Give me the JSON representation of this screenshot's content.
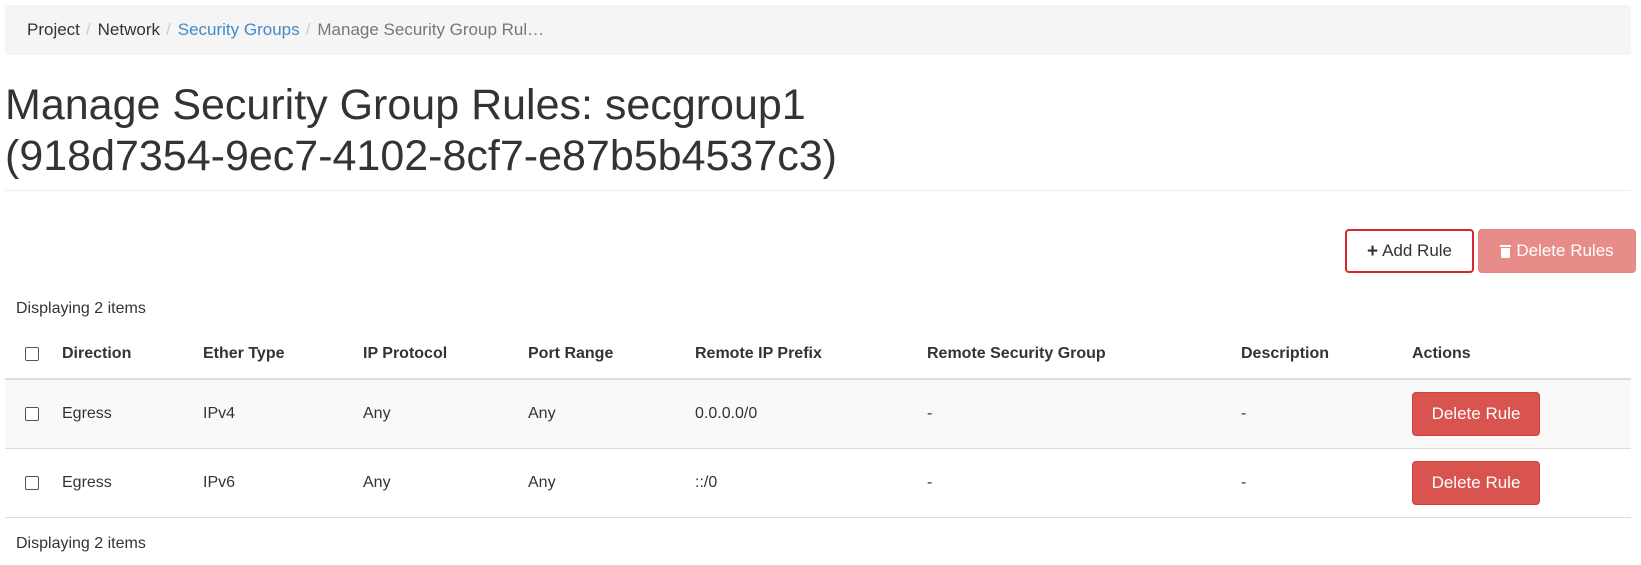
{
  "breadcrumb": {
    "items": [
      "Project",
      "Network",
      "Security Groups",
      "Manage Security Group Rul…"
    ],
    "separator": "/"
  },
  "page": {
    "title_line1": "Manage Security Group Rules: secgroup1",
    "title_line2": "(918d7354-9ec7-4102-8cf7-e87b5b4537c3)"
  },
  "actions": {
    "add_rule_label": "Add Rule",
    "add_rule_icon": "plus-icon",
    "delete_rules_label": "Delete Rules",
    "delete_rules_icon": "trash-icon"
  },
  "table": {
    "count_text": "Displaying 2 items",
    "columns": [
      "Direction",
      "Ether Type",
      "IP Protocol",
      "Port Range",
      "Remote IP Prefix",
      "Remote Security Group",
      "Description",
      "Actions"
    ],
    "rows": [
      {
        "direction": "Egress",
        "ether_type": "IPv4",
        "ip_protocol": "Any",
        "port_range": "Any",
        "remote_ip_prefix": "0.0.0.0/0",
        "remote_security_group": "-",
        "description": "-",
        "action_label": "Delete Rule"
      },
      {
        "direction": "Egress",
        "ether_type": "IPv6",
        "ip_protocol": "Any",
        "port_range": "Any",
        "remote_ip_prefix": "::/0",
        "remote_security_group": "-",
        "description": "-",
        "action_label": "Delete Rule"
      }
    ]
  },
  "colors": {
    "link": "#428bca",
    "danger": "#d9534f",
    "danger_disabled": "#e88c8a",
    "highlight_border": "#d9262e",
    "breadcrumb_bg": "#f5f5f5"
  }
}
